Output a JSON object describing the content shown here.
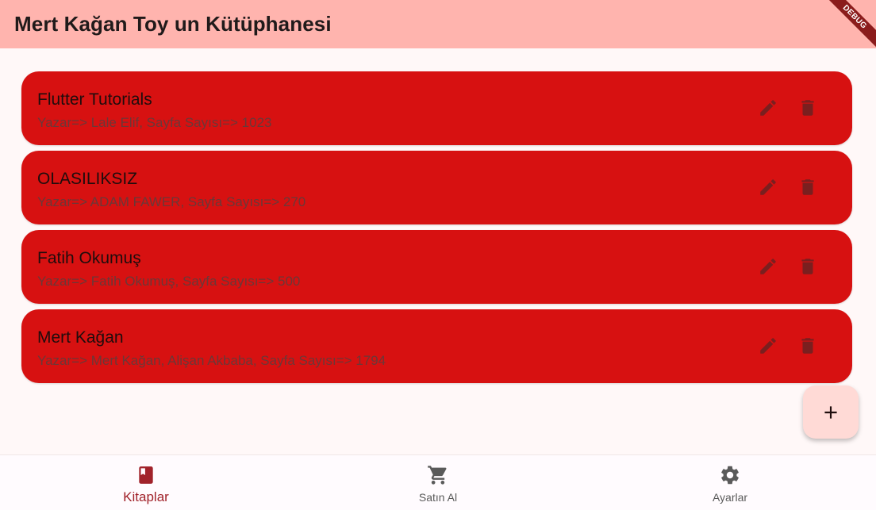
{
  "appbar": {
    "title": "Mert Kağan Toy un Kütüphanesi",
    "debug_label": "DEBUG",
    "bg_color": "#ffb4ae"
  },
  "books": [
    {
      "title": "Flutter Tutorials",
      "subtitle": "Yazar=> Lale Elif, Sayfa Sayısı=> 1023"
    },
    {
      "title": "OLASILIKSIZ",
      "subtitle": "Yazar=> ADAM FAWER, Sayfa Sayısı=> 270"
    },
    {
      "title": "Fatih Okumuş",
      "subtitle": "Yazar=> Fatih Okumuş, Sayfa Sayısı=> 500"
    },
    {
      "title": "Mert Kağan",
      "subtitle": "Yazar=> Mert Kağan, Alişan Akbaba, Sayfa Sayısı=> 1794"
    }
  ],
  "card_color": "#d71111",
  "fab": {
    "icon": "plus-icon",
    "color": "#ffdad6"
  },
  "bottom_nav": {
    "items": [
      {
        "label": "Kitaplar",
        "icon": "book-icon",
        "active": true
      },
      {
        "label": "Satın Al",
        "icon": "cart-icon",
        "active": false
      },
      {
        "label": "Ayarlar",
        "icon": "settings-icon",
        "active": false
      }
    ],
    "active_color": "#a1222a",
    "inactive_color": "#5a5a5a"
  }
}
